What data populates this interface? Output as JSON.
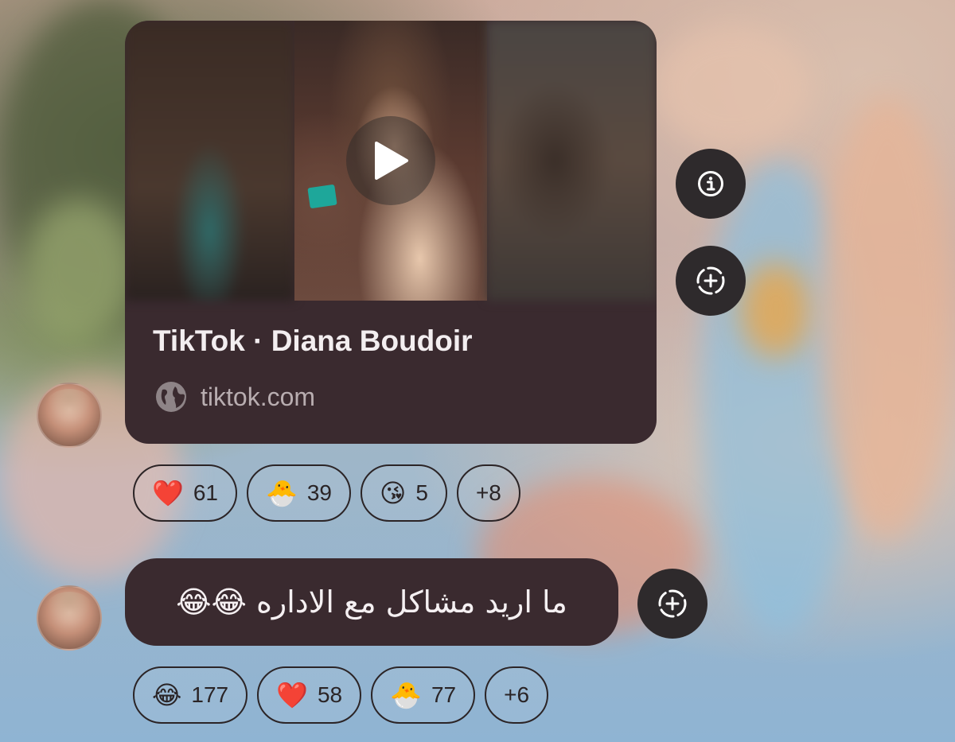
{
  "card": {
    "title": "TikTok · Diana Boudoir",
    "domain": "tiktok.com"
  },
  "buttons": {
    "info_icon": "info-icon",
    "add_reaction_icon": "add-reaction-icon"
  },
  "reactions_1": [
    {
      "emoji": "❤️",
      "count": "61"
    },
    {
      "emoji": "🐣",
      "count": "39"
    },
    {
      "emoji": "😘",
      "count": "5"
    },
    {
      "emoji": "",
      "count": "+8"
    }
  ],
  "message": {
    "text": "ما اريد مشاكل مع الاداره 😂😂"
  },
  "reactions_2": [
    {
      "emoji": "😂",
      "count": "177"
    },
    {
      "emoji": "❤️",
      "count": "58"
    },
    {
      "emoji": "🐣",
      "count": "77"
    },
    {
      "emoji": "",
      "count": "+6"
    }
  ]
}
